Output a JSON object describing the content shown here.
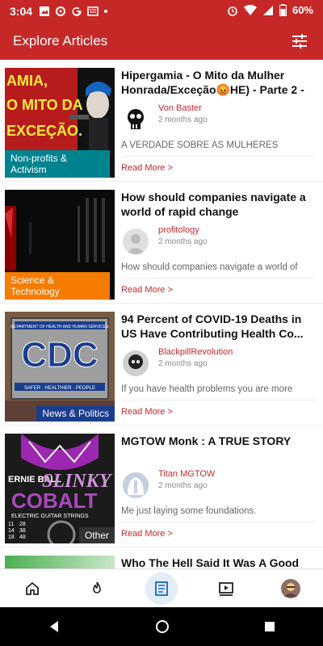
{
  "status_bar": {
    "time": "3:04",
    "battery": "60%"
  },
  "app_bar": {
    "title": "Explore Articles"
  },
  "articles": [
    {
      "title": "Hipergamia - O Mito da Mulher Honrada/Exceção😡HE) - Parte 2 - ...",
      "category": "Non-profits & Activism",
      "author": "Von Baster",
      "date": "2 months ago",
      "excerpt": "A VERDADE SOBRE AS MULHERES",
      "read_more": "Read More >"
    },
    {
      "title": "How should companies navigate a world of rapid change",
      "category": "Science & Technology",
      "author": "profitology",
      "date": "2 months ago",
      "excerpt": "How should companies navigate a world of",
      "read_more": "Read More >"
    },
    {
      "title": "94 Percent of COVID-19 Deaths in US Have Contributing Health Co...",
      "category": "News & Politics",
      "author": "BlackpillRevolution",
      "date": "2 months ago",
      "excerpt": "If you have health problems you are more",
      "read_more": "Read More >"
    },
    {
      "title": "MGTOW Monk : A TRUE STORY",
      "category": "Other",
      "author": "Titan MGTOW",
      "date": "2 months ago",
      "excerpt": "Me just laying some foundations.",
      "read_more": "Read More >"
    },
    {
      "title": "Who The Hell Said It Was A Good"
    }
  ],
  "thumb_text": {
    "a1_top": "AMIA,",
    "a1_mid": "O MITO DA",
    "a1_bottom": "EXCEÇÃO.",
    "cdc_banner": "DEPARTMENT OF HEALTH AND HUMAN SERVICES",
    "cdc": "CDC",
    "cdc_sub": "SAFER · HEALTHIER · PEOPLE",
    "ernie": "ERNIE BALL",
    "slinky": "SLINKY",
    "cobalt": "COBALT",
    "strings": "ELECTRIC GUITAR STRINGS",
    "gauges": [
      "11",
      "14",
      "18",
      "28",
      "38",
      "48"
    ]
  },
  "bottom_nav": [
    "home-icon",
    "trending-icon",
    "articles-icon",
    "videos-icon",
    "profile-avatar"
  ],
  "colors": {
    "accent": "#c62828",
    "science_tag": "#f57c00",
    "nonprofit_tag": "#00838f",
    "news_tag": "#1a3e8c",
    "other_tag": "#333333"
  }
}
